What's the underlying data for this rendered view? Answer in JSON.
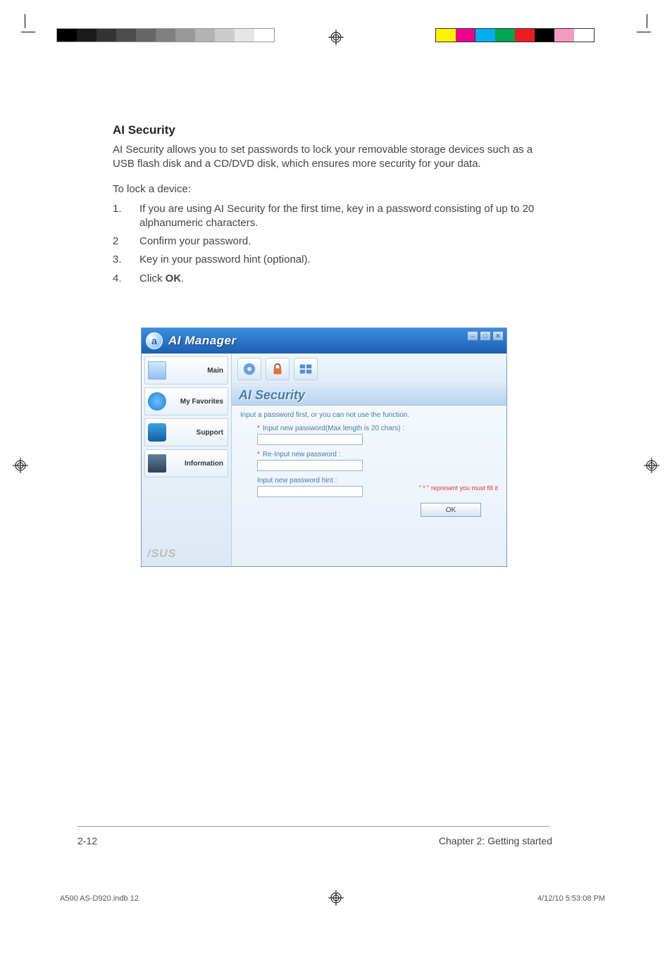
{
  "heading": "AI Security",
  "intro": "AI Security allows you to set passwords to lock your removable storage devices such as a USB flash disk and a CD/DVD disk, which ensures more security for your data.",
  "lead": "To lock a device:",
  "steps": [
    {
      "num": "1.",
      "text": "If you are using AI Security for the first time, key in a password consisting of up to 20 alphanumeric characters."
    },
    {
      "num": "2",
      "text": "Confirm your password."
    },
    {
      "num": "3.",
      "text": "Key in your password hint (optional)."
    },
    {
      "num": "4.",
      "text_prefix": "Click ",
      "bold": "OK",
      "text_suffix": "."
    }
  ],
  "app": {
    "title": "AI Manager",
    "sidebar": {
      "items": [
        {
          "label": "Main"
        },
        {
          "label": "My Favorites"
        },
        {
          "label": "Support"
        },
        {
          "label": "Information"
        }
      ],
      "brand": "/SUS"
    },
    "section_title": "AI Security",
    "form": {
      "instruction": "Input a password first, or you can not use the function.",
      "field1_label": "Input new password(Max length is 20 chars) :",
      "field2_label": "Re-Input new password :",
      "field3_label": "Input new password hint :",
      "required_note": "\" * \" represent you must fill it",
      "ok_label": "OK"
    }
  },
  "footer": {
    "page": "2-12",
    "chapter": "Chapter 2: Getting started"
  },
  "slug": {
    "file": "A500 AS-D920.indb   12",
    "date": "4/12/10   5:53:08 PM"
  },
  "colors": {
    "grays": [
      "#000",
      "#1a1a1a",
      "#333",
      "#4d4d4d",
      "#666",
      "#808080",
      "#999",
      "#b3b3b3",
      "#ccc",
      "#e6e6e6",
      "#fff"
    ],
    "cmyk": [
      "#00aeef",
      "#ec008c",
      "#fff200",
      "#000000",
      "#00a651",
      "#ed1c24",
      "#2e3192",
      "#f7941d",
      "#92278f",
      "#fff"
    ]
  }
}
